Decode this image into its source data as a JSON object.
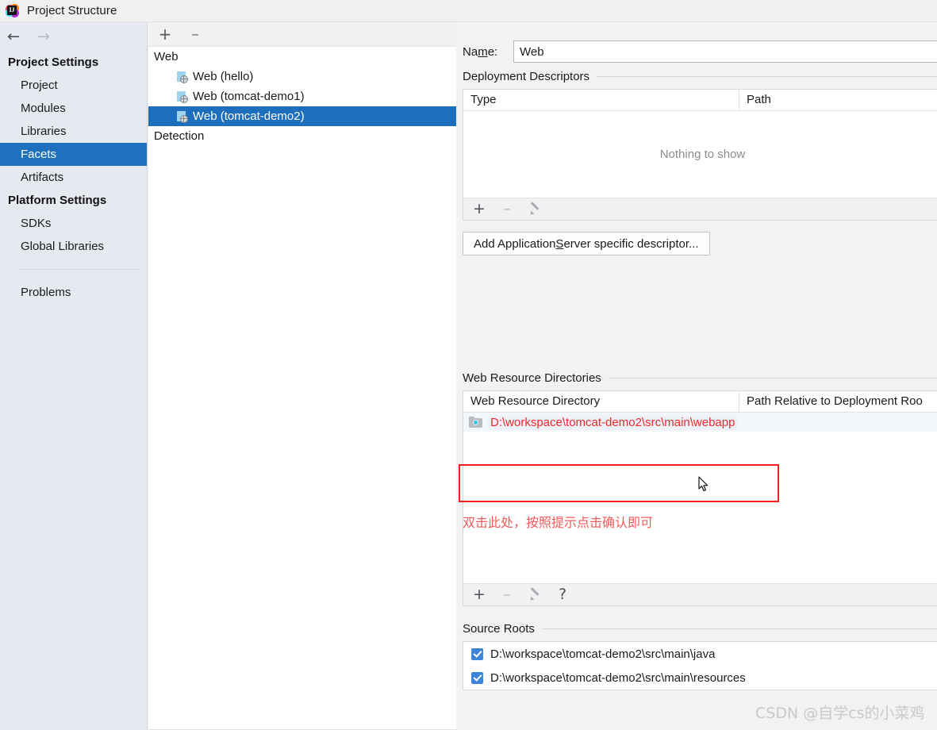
{
  "window": {
    "title": "Project Structure",
    "app_icon": "intellij-idea-icon",
    "icon_letters": "IJ"
  },
  "nav": {
    "back_icon": "arrow-left-icon",
    "forward_icon": "arrow-right-icon"
  },
  "sidebar": {
    "groups": [
      {
        "label": "Project Settings",
        "items": [
          {
            "label": "Project",
            "selected": false
          },
          {
            "label": "Modules",
            "selected": false
          },
          {
            "label": "Libraries",
            "selected": false
          },
          {
            "label": "Facets",
            "selected": true
          },
          {
            "label": "Artifacts",
            "selected": false
          }
        ]
      },
      {
        "label": "Platform Settings",
        "items": [
          {
            "label": "SDKs",
            "selected": false
          },
          {
            "label": "Global Libraries",
            "selected": false
          }
        ]
      }
    ],
    "problems_label": "Problems",
    "selection_color": "#1e72bd"
  },
  "tree": {
    "toolbar": {
      "add_label": "+",
      "remove_label": "–"
    },
    "rows": [
      {
        "label": "Web",
        "child": false,
        "selected": false,
        "icon": ""
      },
      {
        "label": "Web (hello)",
        "child": true,
        "selected": false,
        "icon": "web-facet-icon"
      },
      {
        "label": "Web (tomcat-demo1)",
        "child": true,
        "selected": false,
        "icon": "web-facet-icon"
      },
      {
        "label": "Web (tomcat-demo2)",
        "child": true,
        "selected": true,
        "icon": "web-facet-icon"
      },
      {
        "label": "Detection",
        "child": false,
        "selected": false,
        "icon": ""
      }
    ],
    "selection_color": "#1d6fbd"
  },
  "content": {
    "name_label_pre": "Na",
    "name_label_mnemonic": "m",
    "name_label_post": "e:",
    "name_value": "Web",
    "deployment": {
      "section_label": "Deployment Descriptors",
      "columns": [
        "Type",
        "Path"
      ],
      "empty_text": "Nothing to show",
      "toolbar": {
        "add": "+",
        "remove": "–",
        "edit_icon": "pencil-icon"
      },
      "add_descriptor_pre": "Add Application ",
      "add_descriptor_mnemonic": "S",
      "add_descriptor_post": "erver specific descriptor..."
    },
    "web_resources": {
      "section_label": "Web Resource Directories",
      "columns": [
        "Web Resource Directory",
        "Path Relative to Deployment Roo"
      ],
      "rows": [
        {
          "icon": "folder-web-icon",
          "path": "D:\\workspace\\tomcat-demo2\\src\\main\\webapp"
        }
      ],
      "toolbar": {
        "add": "+",
        "remove": "–",
        "edit_icon": "pencil-icon",
        "help": "?"
      },
      "annotation_text": "双击此处，按照提示点击确认即可",
      "annotation_color": "#f35a5a",
      "highlight_box_color": "#f32020",
      "path_text_color": "#ec2a2a"
    },
    "source_roots": {
      "section_label": "Source Roots",
      "rows": [
        {
          "checked": true,
          "path": "D:\\workspace\\tomcat-demo2\\src\\main\\java"
        },
        {
          "checked": true,
          "path": "D:\\workspace\\tomcat-demo2\\src\\main\\resources"
        }
      ]
    }
  },
  "watermark": {
    "text": "CSDN @自学cs的小菜鸡"
  }
}
